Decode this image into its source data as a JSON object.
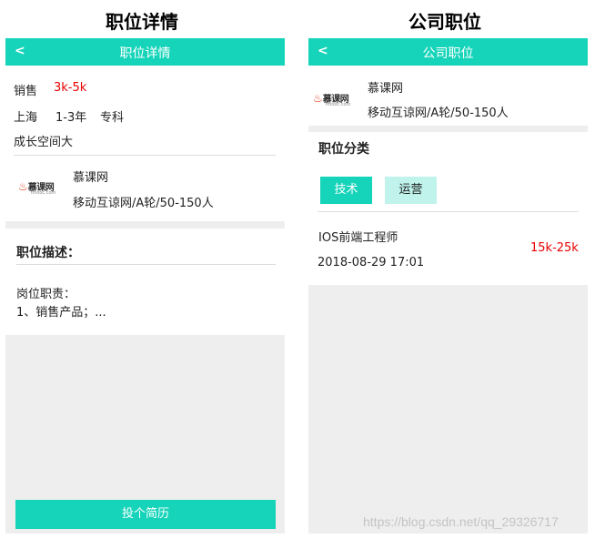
{
  "left": {
    "caption": "职位详情",
    "header": {
      "back_label": "<",
      "title": "职位详情"
    },
    "job": {
      "name": "销售",
      "salary": "3k-5k",
      "city": "上海",
      "experience": "1-3年",
      "education": "专科",
      "perk": "成长空间大"
    },
    "company": {
      "logo_text": "慕课网",
      "logo_domain": "imooc.com",
      "name": "慕课网",
      "info": "移动互谅网/A轮/50-150人"
    },
    "description": {
      "heading": "职位描述：",
      "line1": "岗位职责：",
      "line2": "1、销售产品；..."
    },
    "apply_label": "投个简历"
  },
  "right": {
    "caption": "公司职位",
    "header": {
      "back_label": "<",
      "title": "公司职位"
    },
    "company": {
      "logo_text": "慕课网",
      "logo_domain": "imooc.com",
      "name": "慕课网",
      "info": "移动互谅网/A轮/50-150人"
    },
    "category": {
      "heading": "职位分类",
      "tabs": [
        {
          "label": "技术"
        },
        {
          "label": "运营"
        }
      ]
    },
    "job_item": {
      "title": "IOS前端工程师",
      "date": "2018-08-29 17:01",
      "salary": "15k-25k"
    }
  },
  "watermark": "https://blog.csdn.net/qq_29326717",
  "colors": {
    "accent": "#16d4b9",
    "salary": "#e80000",
    "tab_inactive": "#bff3ec",
    "panel_gray": "#eeeeee"
  }
}
